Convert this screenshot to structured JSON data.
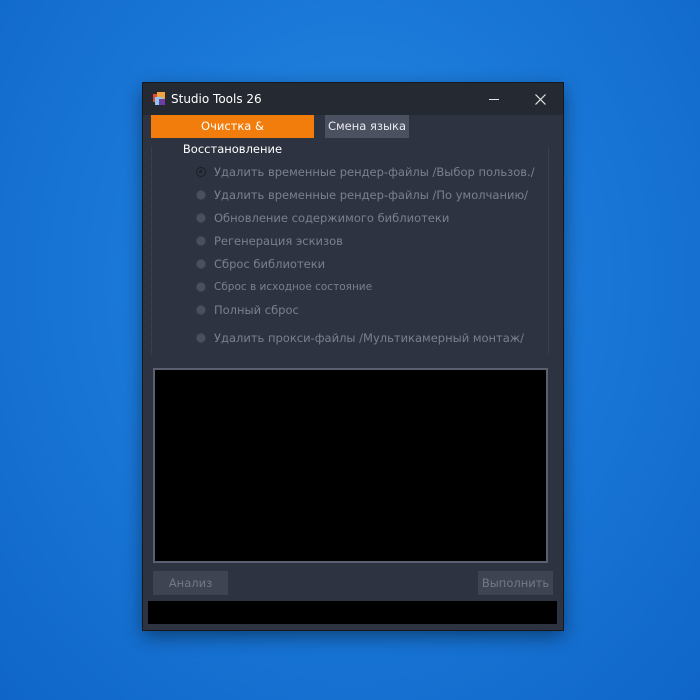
{
  "window": {
    "title": "Studio Tools 26"
  },
  "tabs": [
    {
      "label": "Очистка & Восстановление",
      "active": true
    },
    {
      "label": "Смена языка",
      "active": false
    }
  ],
  "options": [
    {
      "label": "Удалить временные рендер-файлы /Выбор пользов./",
      "checked": true
    },
    {
      "label": "Удалить временные рендер-файлы /По умолчанию/",
      "checked": false
    },
    {
      "label": "Обновление содержимого библиотеки",
      "checked": false
    },
    {
      "label": "Регенерация эскизов",
      "checked": false
    },
    {
      "label": "Сброс библиотеки",
      "checked": false
    },
    {
      "label": "Сброс в исходное состояние",
      "checked": false
    },
    {
      "label": "Полный сброс",
      "checked": false
    },
    {
      "label": "Удалить прокси-файлы /Мультикамерный монтаж/",
      "checked": false
    }
  ],
  "buttons": {
    "analyze": "Анализ",
    "run": "Выполнить"
  },
  "colors": {
    "accent": "#f27d0c",
    "window_bg": "#2d3340",
    "titlebar_bg": "#252932",
    "desktop": "#1a78d8"
  },
  "icons": {
    "app": "studio-tools-icon",
    "minimize": "minimize-icon",
    "close": "close-icon"
  }
}
